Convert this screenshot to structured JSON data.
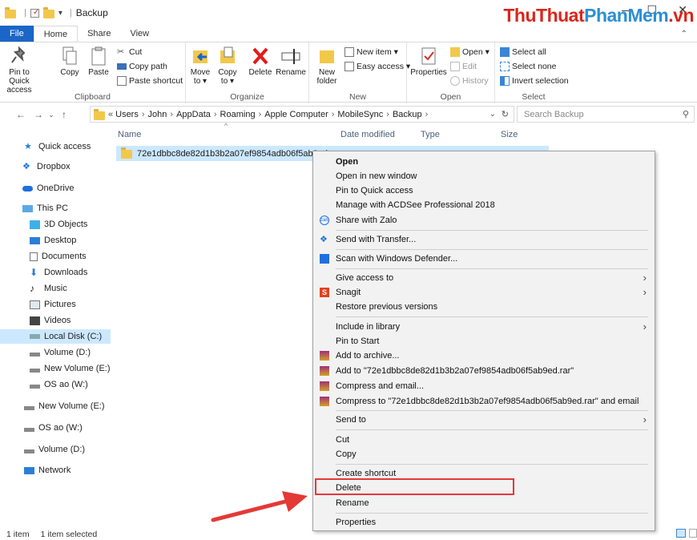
{
  "window": {
    "title": "Backup",
    "brand_part1": "ThuThuat",
    "brand_part2": "PhanMem",
    "brand_part3": ".vn"
  },
  "ribbon_tabs": [
    "File",
    "Home",
    "Share",
    "View"
  ],
  "ribbon": {
    "clipboard": {
      "label": "Clipboard",
      "pin": "Pin to Quick access",
      "copy": "Copy",
      "paste": "Paste",
      "cut": "Cut",
      "copy_path": "Copy path",
      "paste_shortcut": "Paste shortcut"
    },
    "organize": {
      "label": "Organize",
      "move_to": "Move to",
      "copy_to": "Copy to",
      "delete": "Delete",
      "rename": "Rename"
    },
    "new": {
      "label": "New",
      "new_folder": "New folder",
      "new_item": "New item",
      "easy_access": "Easy access"
    },
    "open": {
      "label": "Open",
      "properties": "Properties",
      "open": "Open",
      "edit": "Edit",
      "history": "History"
    },
    "select": {
      "label": "Select",
      "select_all": "Select all",
      "select_none": "Select none",
      "invert": "Invert selection"
    }
  },
  "address": {
    "prefix": "«",
    "crumbs": [
      "Users",
      "John",
      "AppData",
      "Roaming",
      "Apple Computer",
      "MobileSync",
      "Backup"
    ],
    "search_placeholder": "Search Backup"
  },
  "nav": [
    {
      "label": "Quick access",
      "icon": "star-icon"
    },
    {
      "label": "Dropbox",
      "icon": "dropbox-icon"
    },
    {
      "label": "OneDrive",
      "icon": "cloud-icon"
    },
    {
      "label": "This PC",
      "icon": "pc-icon"
    },
    {
      "label": "3D Objects",
      "icon": "cube-icon"
    },
    {
      "label": "Desktop",
      "icon": "desktop-icon"
    },
    {
      "label": "Documents",
      "icon": "document-icon"
    },
    {
      "label": "Downloads",
      "icon": "download-icon"
    },
    {
      "label": "Music",
      "icon": "music-icon"
    },
    {
      "label": "Pictures",
      "icon": "picture-icon"
    },
    {
      "label": "Videos",
      "icon": "video-icon"
    },
    {
      "label": "Local Disk (C:)",
      "icon": "drive-icon"
    },
    {
      "label": "Volume (D:)",
      "icon": "drive-icon"
    },
    {
      "label": "New Volume (E:)",
      "icon": "drive-icon"
    },
    {
      "label": "OS ao (W:)",
      "icon": "drive-icon"
    },
    {
      "label": "New Volume (E:)",
      "icon": "drive-icon"
    },
    {
      "label": "OS ao (W:)",
      "icon": "drive-icon"
    },
    {
      "label": "Volume (D:)",
      "icon": "drive-icon"
    },
    {
      "label": "Network",
      "icon": "network-icon"
    }
  ],
  "columns": [
    "Name",
    "Date modified",
    "Type",
    "Size"
  ],
  "file": {
    "name": "72e1dbbc8de82d1b3b2a07ef9854adb06f5ab9ed"
  },
  "status": {
    "count": "1 item",
    "selected": "1 item selected"
  },
  "context_menu": {
    "open": "Open",
    "open_new_window": "Open in new window",
    "pin_quick": "Pin to Quick access",
    "acdsee": "Manage with ACDSee Professional 2018",
    "zalo": "Share with Zalo",
    "transfer": "Send with Transfer...",
    "defender": "Scan with Windows Defender...",
    "give_access": "Give access to",
    "snagit": "Snagit",
    "restore": "Restore previous versions",
    "include_library": "Include in library",
    "pin_start": "Pin to Start",
    "add_archive": "Add to archive...",
    "add_rar": "Add to \"72e1dbbc8de82d1b3b2a07ef9854adb06f5ab9ed.rar\"",
    "compress_email": "Compress and email...",
    "compress_rar_email": "Compress to \"72e1dbbc8de82d1b3b2a07ef9854adb06f5ab9ed.rar\" and email",
    "send_to": "Send to",
    "cut": "Cut",
    "copy": "Copy",
    "create_shortcut": "Create shortcut",
    "delete": "Delete",
    "rename": "Rename",
    "properties": "Properties"
  }
}
